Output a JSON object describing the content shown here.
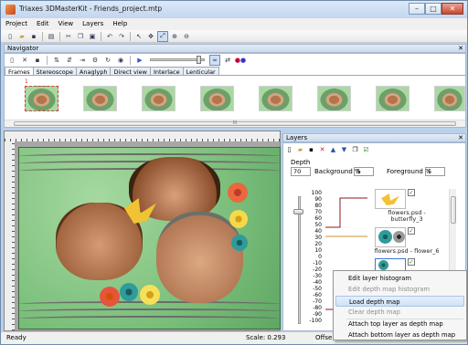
{
  "window": {
    "title": "Triaxes 3DMasterKit - Friends_project.mtp",
    "minimize_icon": "minimize-icon",
    "maximize_icon": "maximize-icon",
    "close_icon": "close-icon"
  },
  "menu": [
    "Project",
    "Edit",
    "View",
    "Layers",
    "Help"
  ],
  "navigator": {
    "title": "Navigator",
    "close_label": "✕",
    "tabs": [
      "Frames",
      "Stereoscope",
      "Anaglyph",
      "Direct view",
      "Interlace",
      "Lenticular"
    ],
    "active_tab": "Frames",
    "first_frame_number": "1",
    "scroll_label": "III"
  },
  "layers_panel": {
    "title": "Layers",
    "close_label": "✕",
    "depth_label": "Depth",
    "depth_value": "70",
    "background_label": "Background %",
    "background_value": "5",
    "foreground_label": "Foreground %",
    "foreground_value": "5",
    "depth_ticks": [
      "100",
      "90",
      "80",
      "70",
      "60",
      "50",
      "40",
      "30",
      "20",
      "10",
      "0",
      "-10",
      "-20",
      "-30",
      "-40",
      "-50",
      "-60",
      "-70",
      "-80",
      "-90",
      "-100"
    ],
    "layers": [
      {
        "name": "flowers.psd -\nbutterfly_3",
        "visible": true
      },
      {
        "name": "flowers.psd - flower_6",
        "visible": true
      },
      {
        "name": "",
        "visible": true
      }
    ]
  },
  "context_menu": {
    "items": [
      {
        "label": "Edit layer histogram",
        "enabled": true,
        "highlighted": false
      },
      {
        "label": "Edit depth map histogram",
        "enabled": false,
        "highlighted": false
      },
      {
        "label": "Load depth map",
        "enabled": true,
        "highlighted": true
      },
      {
        "label": "Clear depth map",
        "enabled": false,
        "highlighted": false
      },
      {
        "label": "Attach top layer as depth map",
        "enabled": true,
        "highlighted": false
      },
      {
        "label": "Attach bottom layer as depth map",
        "enabled": true,
        "highlighted": false
      }
    ]
  },
  "status": {
    "left": "Ready",
    "scale": "Scale: 0.293",
    "offset": "Offse"
  },
  "colors": {
    "title_bar": "#c2d6ee",
    "panel_header": "#cbdaec",
    "highlight": "#cfe1f7",
    "photo_frame": "#7bbf7b"
  }
}
